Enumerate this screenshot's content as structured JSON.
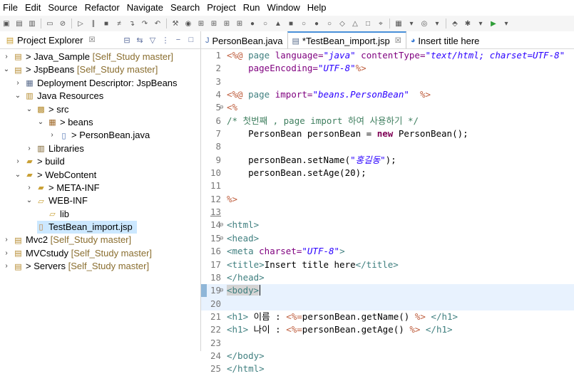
{
  "menu": [
    "File",
    "Edit",
    "Source",
    "Refactor",
    "Navigate",
    "Search",
    "Project",
    "Run",
    "Window",
    "Help"
  ],
  "explorer": {
    "title": "Project Explorer",
    "close": "☒",
    "tree": [
      {
        "depth": 0,
        "chev": ">",
        "icon": "project-icon",
        "label": "> Java_Sample",
        "decor": "[Self_Study master]"
      },
      {
        "depth": 0,
        "chev": "v",
        "icon": "project-icon",
        "label": "> JspBeans",
        "decor": "[Self_Study master]"
      },
      {
        "depth": 1,
        "chev": ">",
        "icon": "descriptor-icon",
        "label": "Deployment Descriptor: JspBeans",
        "decor": ""
      },
      {
        "depth": 1,
        "chev": "v",
        "icon": "java-resources-icon",
        "label": "Java Resources",
        "decor": ""
      },
      {
        "depth": 2,
        "chev": "v",
        "icon": "source-folder-icon",
        "label": "> src",
        "decor": ""
      },
      {
        "depth": 3,
        "chev": "v",
        "icon": "package-icon",
        "label": "> beans",
        "decor": ""
      },
      {
        "depth": 4,
        "chev": ">",
        "icon": "java-file-icon",
        "label": "> PersonBean.java",
        "decor": ""
      },
      {
        "depth": 2,
        "chev": ">",
        "icon": "library-icon",
        "label": "Libraries",
        "decor": ""
      },
      {
        "depth": 1,
        "chev": ">",
        "icon": "folder-icon",
        "label": "> build",
        "decor": ""
      },
      {
        "depth": 1,
        "chev": "v",
        "icon": "folder-icon",
        "label": "> WebContent",
        "decor": ""
      },
      {
        "depth": 2,
        "chev": ">",
        "icon": "folder-icon",
        "label": "> META-INF",
        "decor": ""
      },
      {
        "depth": 2,
        "chev": "v",
        "icon": "open-folder-icon",
        "label": "WEB-INF",
        "decor": ""
      },
      {
        "depth": 3,
        "chev": "",
        "icon": "open-folder-icon",
        "label": "lib",
        "decor": ""
      },
      {
        "depth": 2,
        "chev": "",
        "icon": "jsp-file-icon",
        "label": "TestBean_import.jsp",
        "decor": "",
        "selected": true
      },
      {
        "depth": 0,
        "chev": ">",
        "icon": "project-icon",
        "label": "Mvc2",
        "decor": "[Self_Study master]"
      },
      {
        "depth": 0,
        "chev": ">",
        "icon": "project-icon",
        "label": "MVCstudy",
        "decor": "[Self_Study master]"
      },
      {
        "depth": 0,
        "chev": ">",
        "icon": "project-icon",
        "label": "> Servers",
        "decor": "[Self_Study master]"
      }
    ]
  },
  "editor": {
    "tabs": [
      {
        "label": "PersonBean.java",
        "active": false,
        "close": ""
      },
      {
        "label": "*TestBean_import.jsp",
        "active": true,
        "close": "☒"
      },
      {
        "label": "Insert title here",
        "active": false,
        "close": ""
      }
    ],
    "lines": [
      {
        "n": "1",
        "fold": "",
        "tokens": [
          [
            "delim",
            "<%@ "
          ],
          [
            "tag",
            "page "
          ],
          [
            "attr",
            "language="
          ],
          [
            "str",
            "\"java\" "
          ],
          [
            "attr",
            "contentType="
          ],
          [
            "str",
            "\"text/html; charset=UTF-8\""
          ]
        ]
      },
      {
        "n": "2",
        "fold": "",
        "tokens": [
          [
            "plain",
            "    "
          ],
          [
            "attr",
            "pageEncoding="
          ],
          [
            "str",
            "\"UTF-8\""
          ],
          [
            "delim",
            "%>"
          ]
        ]
      },
      {
        "n": "3",
        "fold": "",
        "tokens": []
      },
      {
        "n": "4",
        "fold": "",
        "tokens": [
          [
            "delim",
            "<%@ "
          ],
          [
            "tag",
            "page "
          ],
          [
            "attr",
            "import="
          ],
          [
            "str",
            "\"beans.PersonBean\""
          ],
          [
            "plain",
            "  "
          ],
          [
            "delim",
            "%>"
          ]
        ]
      },
      {
        "n": "5",
        "fold": "⊖",
        "tokens": [
          [
            "delim",
            "<%"
          ]
        ]
      },
      {
        "n": "6",
        "fold": "",
        "tokens": [
          [
            "cmt",
            "/* 첫번째 , page import 하여 사용하기 */"
          ]
        ]
      },
      {
        "n": "7",
        "fold": "",
        "tokens": [
          [
            "plain",
            "    PersonBean personBean = "
          ],
          [
            "kw",
            "new"
          ],
          [
            "plain",
            " PersonBean();"
          ]
        ]
      },
      {
        "n": "8",
        "fold": "",
        "tokens": []
      },
      {
        "n": "9",
        "fold": "",
        "tokens": [
          [
            "plain",
            "    personBean.setName("
          ],
          [
            "str",
            "\"홍길동\""
          ],
          [
            "plain",
            ");"
          ]
        ]
      },
      {
        "n": "10",
        "fold": "",
        "tokens": [
          [
            "plain",
            "    personBean.setAge(20);"
          ]
        ]
      },
      {
        "n": "11",
        "fold": "",
        "tokens": []
      },
      {
        "n": "12",
        "fold": "",
        "tokens": [
          [
            "delim",
            "%>"
          ]
        ]
      },
      {
        "n": "13",
        "fold": "",
        "tokens": [],
        "underline": true
      },
      {
        "n": "14",
        "fold": "⊖",
        "tokens": [
          [
            "tag",
            "<html>"
          ]
        ]
      },
      {
        "n": "15",
        "fold": "⊖",
        "tokens": [
          [
            "tag",
            "<head>"
          ]
        ]
      },
      {
        "n": "16",
        "fold": "",
        "tokens": [
          [
            "tag",
            "<meta "
          ],
          [
            "attr",
            "charset="
          ],
          [
            "str",
            "\"UTF-8\""
          ],
          [
            "tag",
            ">"
          ]
        ]
      },
      {
        "n": "17",
        "fold": "",
        "tokens": [
          [
            "tag",
            "<title>"
          ],
          [
            "plain",
            "Insert title here"
          ],
          [
            "tag",
            "</title>"
          ]
        ]
      },
      {
        "n": "18",
        "fold": "",
        "tokens": [
          [
            "tag",
            "</head>"
          ]
        ]
      },
      {
        "n": "19",
        "fold": "⊖",
        "tokens": [
          [
            "tag",
            "<body>"
          ]
        ],
        "current": true
      },
      {
        "n": "20",
        "fold": "",
        "tokens": [],
        "current": true
      },
      {
        "n": "21",
        "fold": "",
        "tokens": [
          [
            "tag",
            "<h1> "
          ],
          [
            "plain",
            "이름 : "
          ],
          [
            "delim",
            "<%="
          ],
          [
            "plain",
            "personBean.getName() "
          ],
          [
            "delim",
            "%>"
          ],
          [
            "tag",
            " </h1>"
          ]
        ]
      },
      {
        "n": "22",
        "fold": "",
        "tokens": [
          [
            "tag",
            "<h1> "
          ],
          [
            "plain",
            "나이 : "
          ],
          [
            "delim",
            "<%="
          ],
          [
            "plain",
            "personBean.getAge() "
          ],
          [
            "delim",
            "%>"
          ],
          [
            "tag",
            " </h1>"
          ]
        ]
      },
      {
        "n": "23",
        "fold": "",
        "tokens": []
      },
      {
        "n": "24",
        "fold": "",
        "tokens": [
          [
            "tag",
            "</body>"
          ]
        ]
      },
      {
        "n": "25",
        "fold": "",
        "tokens": [
          [
            "tag",
            "</html>"
          ]
        ]
      }
    ]
  }
}
